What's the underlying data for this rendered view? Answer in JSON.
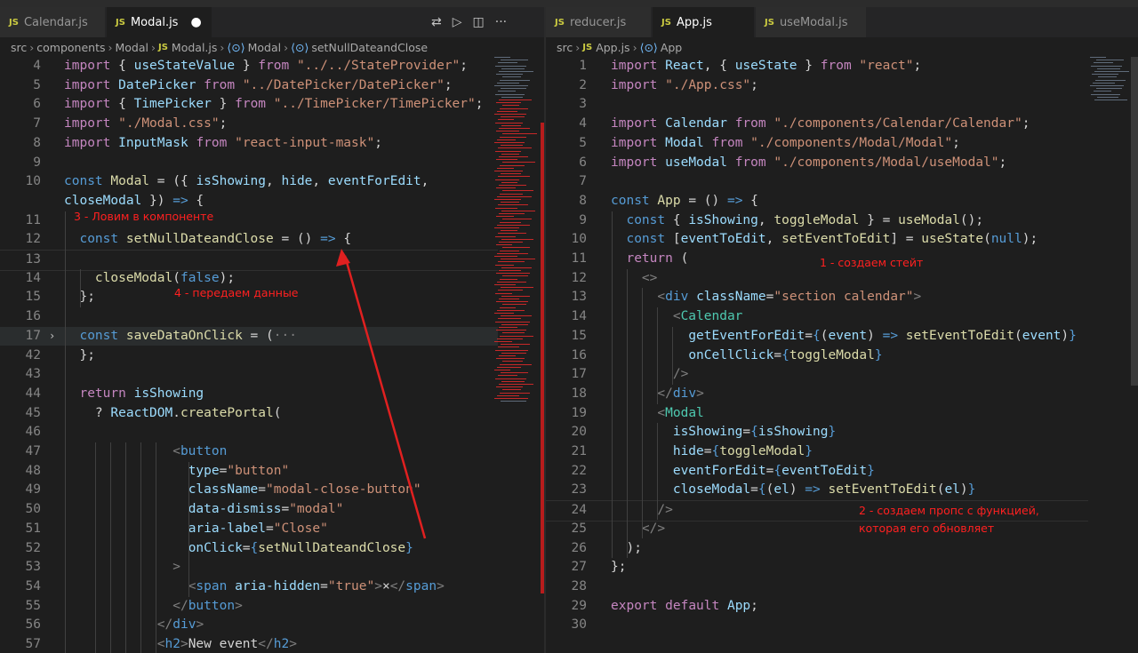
{
  "left": {
    "tabs": [
      {
        "icon": "JS",
        "label": "Calendar.js",
        "active": false
      },
      {
        "icon": "JS",
        "label": "Modal.js",
        "active": true,
        "modified": true
      }
    ],
    "actions": [
      "⇄",
      "▷",
      "◫",
      "···"
    ],
    "breadcrumb": [
      "src",
      "components",
      "Modal",
      "Modal.js",
      "Modal",
      "setNullDateandClose"
    ],
    "lines": [
      {
        "n": "4",
        "html": "<span class='c'>import</span> { <span class='v'>useStateValue</span> } <span class='c'>from</span> <span class='s'>\"../../StateProvider\"</span>;"
      },
      {
        "n": "5",
        "html": "<span class='c'>import</span> <span class='v'>DatePicker</span> <span class='c'>from</span> <span class='s'>\"../DatePicker/DatePicker\"</span>;"
      },
      {
        "n": "6",
        "html": "<span class='c'>import</span> { <span class='v'>TimePicker</span> } <span class='c'>from</span> <span class='s'>\"../TimePicker/TimePicker\"</span>;"
      },
      {
        "n": "7",
        "html": "<span class='c'>import</span> <span class='s'>\"./Modal.css\"</span>;"
      },
      {
        "n": "8",
        "html": "<span class='c'>import</span> <span class='v'>InputMask</span> <span class='c'>from</span> <span class='s'>\"react-input-mask\"</span>;"
      },
      {
        "n": "9",
        "html": ""
      },
      {
        "n": "10",
        "html": "<span class='k'>const</span> <span class='f'>Modal</span> = ({ <span class='v'>isShowing</span>, <span class='v'>hide</span>, <span class='v'>eventForEdit</span>,"
      },
      {
        "n": "",
        "html": "<span class='v'>closeModal</span> }) <span class='k'>=&gt;</span> {"
      },
      {
        "n": "11",
        "html": ""
      },
      {
        "n": "12",
        "html": "  <span class='k'>const</span> <span class='f'>setNullDateandClose</span> = () <span class='k'>=&gt;</span> {"
      },
      {
        "n": "13",
        "html": ""
      },
      {
        "n": "14",
        "html": "    <span class='f'>closeModal</span>(<span class='k'>false</span>);"
      },
      {
        "n": "15",
        "html": "  };"
      },
      {
        "n": "16",
        "html": ""
      },
      {
        "n": "17",
        "html": "  <span class='k'>const</span> <span class='f'>saveDataOnClick</span> = (<span class='p'>···</span>"
      },
      {
        "n": "42",
        "html": "  };"
      },
      {
        "n": "43",
        "html": ""
      },
      {
        "n": "44",
        "html": "  <span class='c'>return</span> <span class='v'>isShowing</span>"
      },
      {
        "n": "45",
        "html": "    ? <span class='v'>ReactDOM</span>.<span class='f'>createPortal</span>("
      },
      {
        "n": "46",
        "html": ""
      },
      {
        "n": "47",
        "html": "              <span class='p'>&lt;</span><span class='k'>button</span>"
      },
      {
        "n": "48",
        "html": "                <span class='v'>type</span>=<span class='s'>\"button\"</span>"
      },
      {
        "n": "49",
        "html": "                <span class='v'>className</span>=<span class='s'>\"modal-close-button\"</span>"
      },
      {
        "n": "50",
        "html": "                <span class='v'>data-dismiss</span>=<span class='s'>\"modal\"</span>"
      },
      {
        "n": "51",
        "html": "                <span class='v'>aria-label</span>=<span class='s'>\"Close\"</span>"
      },
      {
        "n": "52",
        "html": "                <span class='v'>onClick</span>=<span class='k'>{</span><span class='f'>setNullDateandClose</span><span class='k'>}</span>"
      },
      {
        "n": "53",
        "html": "              <span class='p'>&gt;</span>"
      },
      {
        "n": "54",
        "html": "                <span class='p'>&lt;</span><span class='k'>span</span> <span class='v'>aria-hidden</span>=<span class='s'>\"true\"</span><span class='p'>&gt;</span>×<span class='p'>&lt;/</span><span class='k'>span</span><span class='p'>&gt;</span>"
      },
      {
        "n": "55",
        "html": "              <span class='p'>&lt;/</span><span class='k'>button</span><span class='p'>&gt;</span>"
      },
      {
        "n": "56",
        "html": "            <span class='p'>&lt;/</span><span class='k'>div</span><span class='p'>&gt;</span>"
      },
      {
        "n": "57",
        "html": "            <span class='p'>&lt;</span><span class='k'>h2</span><span class='p'>&gt;</span>New event<span class='p'>&lt;/</span><span class='k'>h2</span><span class='p'>&gt;</span>"
      }
    ],
    "annotations": [
      "3 - Ловим в компоненте",
      "4 - передаем данные"
    ]
  },
  "right": {
    "tabs": [
      {
        "icon": "JS",
        "label": "reducer.js",
        "active": false
      },
      {
        "icon": "JS",
        "label": "App.js",
        "active": true
      },
      {
        "icon": "JS",
        "label": "useModal.js",
        "active": false
      }
    ],
    "breadcrumb": [
      "src",
      "App.js",
      "App"
    ],
    "lines": [
      {
        "n": "1",
        "html": "<span class='c'>import</span> <span class='v'>React</span>, { <span class='v'>useState</span> } <span class='c'>from</span> <span class='s'>\"react\"</span>;"
      },
      {
        "n": "2",
        "html": "<span class='c'>import</span> <span class='s'>\"./App.css\"</span>;"
      },
      {
        "n": "3",
        "html": ""
      },
      {
        "n": "4",
        "html": "<span class='c'>import</span> <span class='v'>Calendar</span> <span class='c'>from</span> <span class='s'>\"./components/Calendar/Calendar\"</span>;"
      },
      {
        "n": "5",
        "html": "<span class='c'>import</span> <span class='v'>Modal</span> <span class='c'>from</span> <span class='s'>\"./components/Modal/Modal\"</span>;"
      },
      {
        "n": "6",
        "html": "<span class='c'>import</span> <span class='v'>useModal</span> <span class='c'>from</span> <span class='s'>\"./components/Modal/useModal\"</span>;"
      },
      {
        "n": "7",
        "html": ""
      },
      {
        "n": "8",
        "html": "<span class='k'>const</span> <span class='f'>App</span> = () <span class='k'>=&gt;</span> {"
      },
      {
        "n": "9",
        "html": "  <span class='k'>const</span> { <span class='v'>isShowing</span>, <span class='f'>toggleModal</span> } = <span class='f'>useModal</span>();"
      },
      {
        "n": "10",
        "html": "  <span class='k'>const</span> [<span class='v'>eventToEdit</span>, <span class='f'>setEventToEdit</span>] = <span class='f'>useState</span>(<span class='k'>null</span>);"
      },
      {
        "n": "11",
        "html": "  <span class='c'>return</span> ("
      },
      {
        "n": "12",
        "html": "    <span class='p'>&lt;&gt;</span>"
      },
      {
        "n": "13",
        "html": "      <span class='p'>&lt;</span><span class='k'>div</span> <span class='v'>className</span>=<span class='s'>\"section calendar\"</span><span class='p'>&gt;</span>"
      },
      {
        "n": "14",
        "html": "        <span class='p'>&lt;</span><span class='t'>Calendar</span>"
      },
      {
        "n": "15",
        "html": "          <span class='v'>getEventForEdit</span>=<span class='k'>{</span>(<span class='v'>event</span>) <span class='k'>=&gt;</span> <span class='f'>setEventToEdit</span>(<span class='v'>event</span>)<span class='k'>}</span>"
      },
      {
        "n": "16",
        "html": "          <span class='v'>onCellClick</span>=<span class='k'>{</span><span class='f'>toggleModal</span><span class='k'>}</span>"
      },
      {
        "n": "17",
        "html": "        <span class='p'>/&gt;</span>"
      },
      {
        "n": "18",
        "html": "      <span class='p'>&lt;/</span><span class='k'>div</span><span class='p'>&gt;</span>"
      },
      {
        "n": "19",
        "html": "      <span class='p'>&lt;</span><span class='t'>Modal</span>"
      },
      {
        "n": "20",
        "html": "        <span class='v'>isShowing</span>=<span class='k'>{</span><span class='v'>isShowing</span><span class='k'>}</span>"
      },
      {
        "n": "21",
        "html": "        <span class='v'>hide</span>=<span class='k'>{</span><span class='f'>toggleModal</span><span class='k'>}</span>"
      },
      {
        "n": "22",
        "html": "        <span class='v'>eventForEdit</span>=<span class='k'>{</span><span class='v'>eventToEdit</span><span class='k'>}</span>"
      },
      {
        "n": "23",
        "html": "        <span class='v'>closeModal</span>=<span class='k'>{</span>(<span class='v'>el</span>) <span class='k'>=&gt;</span> <span class='f'>setEventToEdit</span>(<span class='v'>el</span>)<span class='k'>}</span>"
      },
      {
        "n": "24",
        "html": "      <span class='p'>/&gt;</span>"
      },
      {
        "n": "25",
        "html": "    <span class='p'>&lt;/&gt;</span>"
      },
      {
        "n": "26",
        "html": "  );"
      },
      {
        "n": "27",
        "html": "};"
      },
      {
        "n": "28",
        "html": ""
      },
      {
        "n": "29",
        "html": "<span class='c'>export</span> <span class='c'>default</span> <span class='v'>App</span>;"
      },
      {
        "n": "30",
        "html": ""
      }
    ],
    "annotations": [
      "1 - создаем стейт",
      "2 - создаем пропс с функцией,",
      "которая его обновляет"
    ]
  },
  "colors": {
    "annotation": "#ff2020",
    "arrow": "#e02020",
    "keyword": "#569cd6",
    "string": "#ce9178",
    "variable": "#9cdcfe",
    "function": "#dcdcaa",
    "control": "#c586c0",
    "component": "#4ec9b0"
  }
}
